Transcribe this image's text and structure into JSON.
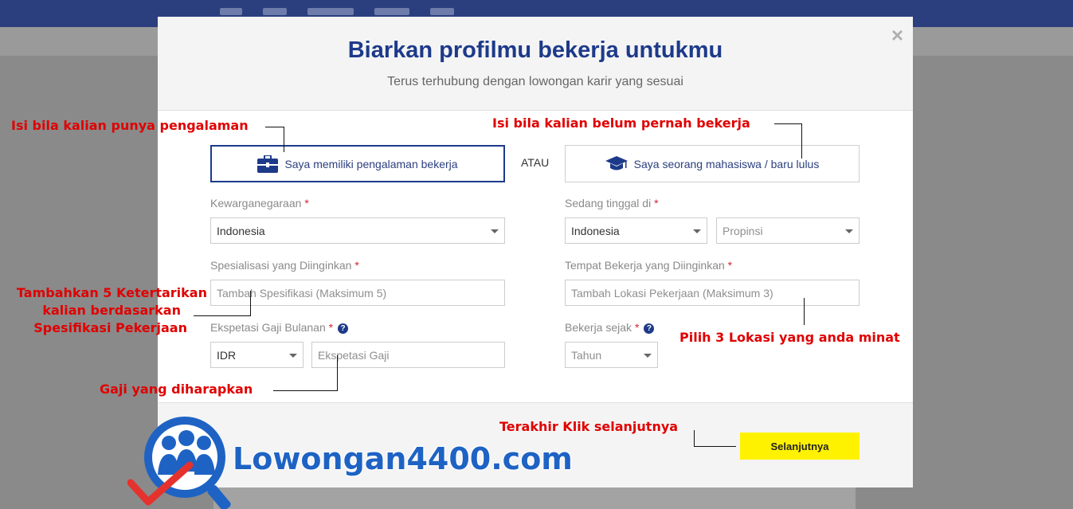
{
  "modal": {
    "title": "Biarkan profilmu bekerja untukmu",
    "subtitle": "Terus terhubung dengan lowongan karir yang sesuai",
    "close_label": "×"
  },
  "choices": {
    "experienced": "Saya memiliki pengalaman bekerja",
    "separator": "ATAU",
    "student": "Saya seorang mahasiswa / baru lulus"
  },
  "form": {
    "nationality": {
      "label": "Kewarganegaraan",
      "value": "Indonesia"
    },
    "residence": {
      "label": "Sedang tinggal di",
      "country_value": "Indonesia",
      "province_placeholder": "Propinsi"
    },
    "specialization": {
      "label": "Spesialisasi yang Diinginkan",
      "placeholder": "Tambah Spesifikasi (Maksimum 5)"
    },
    "work_location": {
      "label": "Tempat Bekerja yang Diinginkan",
      "placeholder": "Tambah Lokasi Pekerjaan (Maksimum 3)"
    },
    "salary": {
      "label": "Ekspetasi Gaji Bulanan",
      "currency": "IDR",
      "placeholder": "Ekspetasi Gaji"
    },
    "work_since": {
      "label": "Bekerja sejak",
      "placeholder": "Tahun"
    },
    "required_mark": "*",
    "help_mark": "?"
  },
  "footer": {
    "next_label": "Selanjutnya"
  },
  "annotations": {
    "experience": "Isi bila kalian punya pengalaman",
    "no_experience": "Isi bila kalian belum pernah bekerja",
    "interests_line1": "Tambahkan 5 Ketertarikan",
    "interests_line2": "kalian berdasarkan",
    "interests_line3": "Spesifikasi Pekerjaan",
    "locations": "Pilih 3 Lokasi yang anda minat",
    "salary": "Gaji yang diharapkan",
    "next": "Terakhir Klik  selanjutnya"
  },
  "watermark": {
    "text": "Lowongan4400.com"
  },
  "colors": {
    "brand": "#1d3a8a",
    "button": "#fff200",
    "annotation": "#e00000",
    "required": "#d9232d"
  },
  "icons": {
    "experienced": "briefcase-icon",
    "student": "graduation-cap-icon",
    "help": "help-circle-icon"
  }
}
